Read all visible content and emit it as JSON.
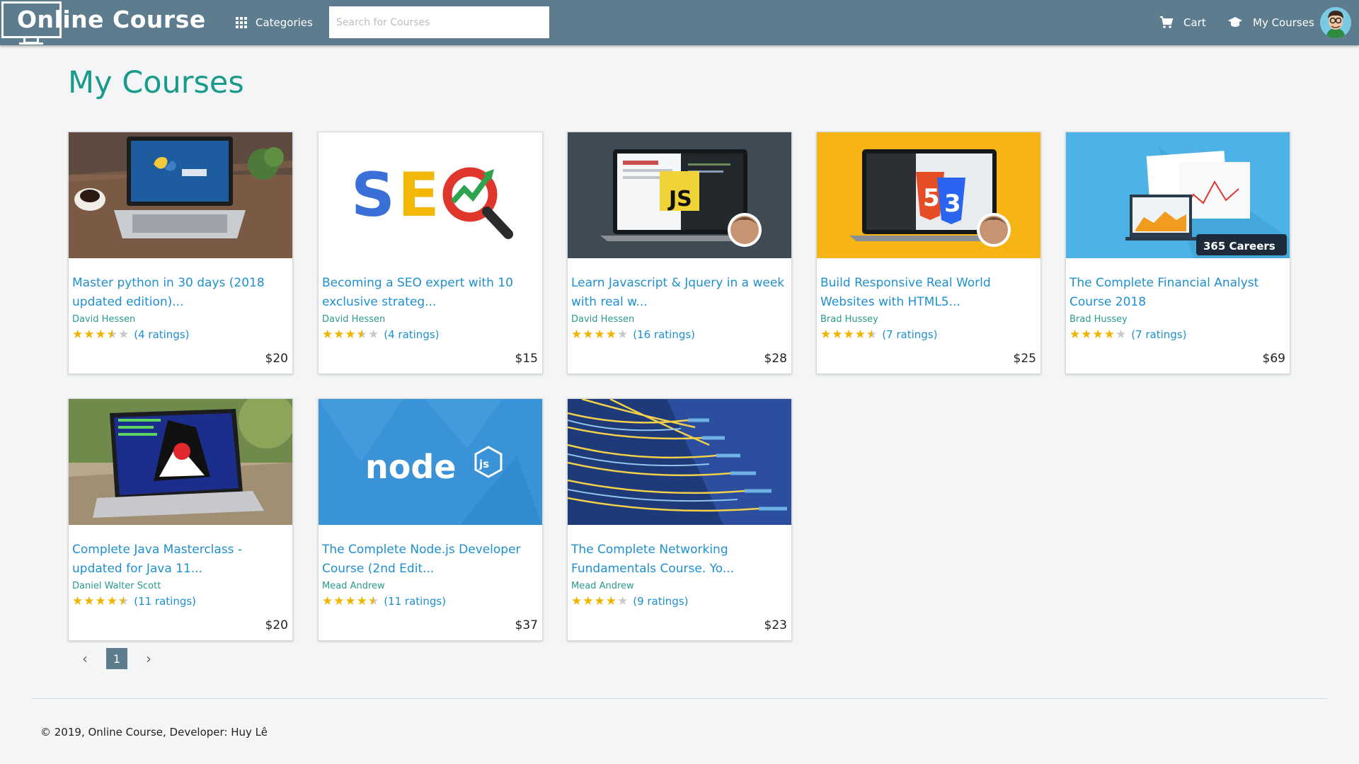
{
  "navbar": {
    "logo_text": "Online Course",
    "categories_label": "Categories",
    "search_placeholder": "Search for Courses",
    "cart_label": "Cart",
    "my_courses_label": "My Courses"
  },
  "page": {
    "title": "My Courses"
  },
  "courses": [
    {
      "title": "Master python in 30 days (2018 updated edition)...",
      "author": "David Hessen",
      "stars": 3.5,
      "ratings": "(4 ratings)",
      "price": "$20",
      "thumb": "python-laptop"
    },
    {
      "title": "Becoming a SEO expert with 10 exclusive strateg...",
      "author": "David Hessen",
      "stars": 3.5,
      "ratings": "(4 ratings)",
      "price": "$15",
      "thumb": "seo"
    },
    {
      "title": "Learn Javascript & Jquery in a week with real w...",
      "author": "David Hessen",
      "stars": 4,
      "ratings": "(16 ratings)",
      "price": "$28",
      "thumb": "javascript"
    },
    {
      "title": "Build Responsive Real World Websites with HTML5...",
      "author": "Brad Hussey",
      "stars": 4.5,
      "ratings": "(7 ratings)",
      "price": "$25",
      "thumb": "html5-css3"
    },
    {
      "title": "The Complete Financial Analyst Course 2018",
      "author": "Brad Hussey",
      "stars": 4,
      "ratings": "(7 ratings)",
      "price": "$69",
      "thumb": "365-careers",
      "badge": "365 Careers"
    },
    {
      "title": "Complete Java Masterclass - updated for Java 11...",
      "author": "Daniel Walter Scott",
      "stars": 4.5,
      "ratings": "(11 ratings)",
      "price": "$20",
      "thumb": "java-laptop"
    },
    {
      "title": "The Complete Node.js Developer Course (2nd Edit...",
      "author": "Mead Andrew",
      "stars": 4.5,
      "ratings": "(11 ratings)",
      "price": "$37",
      "thumb": "nodejs"
    },
    {
      "title": "The Complete Networking Fundamentals Course. Yo...",
      "author": "Mead Andrew",
      "stars": 4,
      "ratings": "(9 ratings)",
      "price": "$23",
      "thumb": "network-cables"
    }
  ],
  "pagination": {
    "current": "1",
    "prev": "‹",
    "next": "›"
  },
  "footer": {
    "text": "© 2019, Online Course, Developer: Huy Lê"
  },
  "thumb_text": {
    "seo": "SEO",
    "js": "JS",
    "node": "node",
    "nodejs_tag": "js",
    "html5": "5",
    "css3": "3"
  },
  "colors": {
    "navbar": "#5d7c8d",
    "title": "#1a9a8a",
    "link": "#1e8fd0",
    "star": "#f0b400"
  }
}
